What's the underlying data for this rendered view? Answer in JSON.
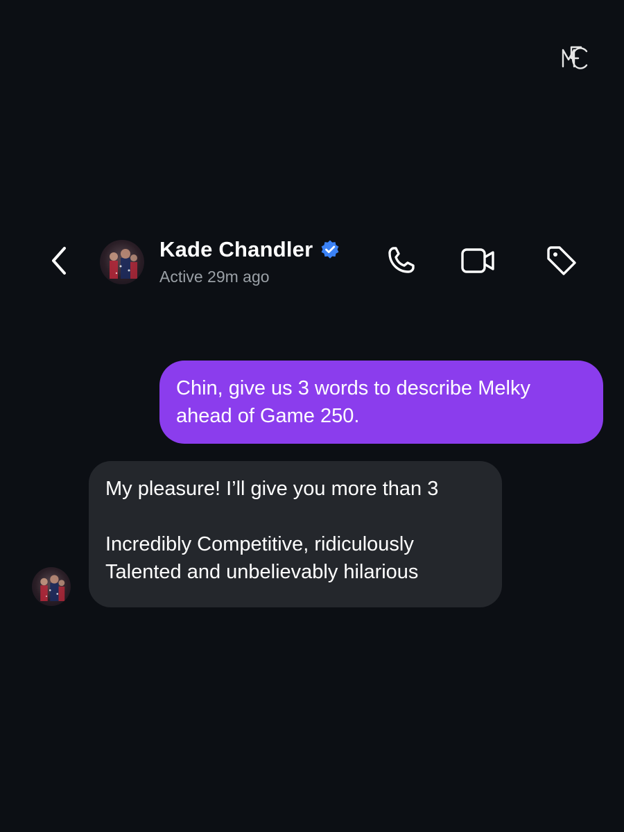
{
  "header": {
    "contact_name": "Kade Chandler",
    "status": "Active 29m ago",
    "icons": {
      "back": "chevron-left-icon",
      "call": "phone-icon",
      "video": "video-camera-icon",
      "tag": "tag-icon",
      "verified": "verified-badge-icon"
    }
  },
  "logo": {
    "name": "club-monogram-logo",
    "text": "MFC"
  },
  "messages": [
    {
      "direction": "sent",
      "lines": [
        "Chin, give us 3 words to describe Melky",
        "ahead of Game 250."
      ]
    },
    {
      "direction": "received",
      "line1": "My pleasure! I’ll give you more than 3",
      "line2": "Incredibly Competitive, ridiculously",
      "line3": "Talented and unbelievably hilarious"
    }
  ],
  "colors": {
    "background": "#0c0f14",
    "sent_bubble": "#8b3ded",
    "received_bubble": "#24272c",
    "verified": "#3b82f6",
    "status_text": "#9aa0a6"
  }
}
